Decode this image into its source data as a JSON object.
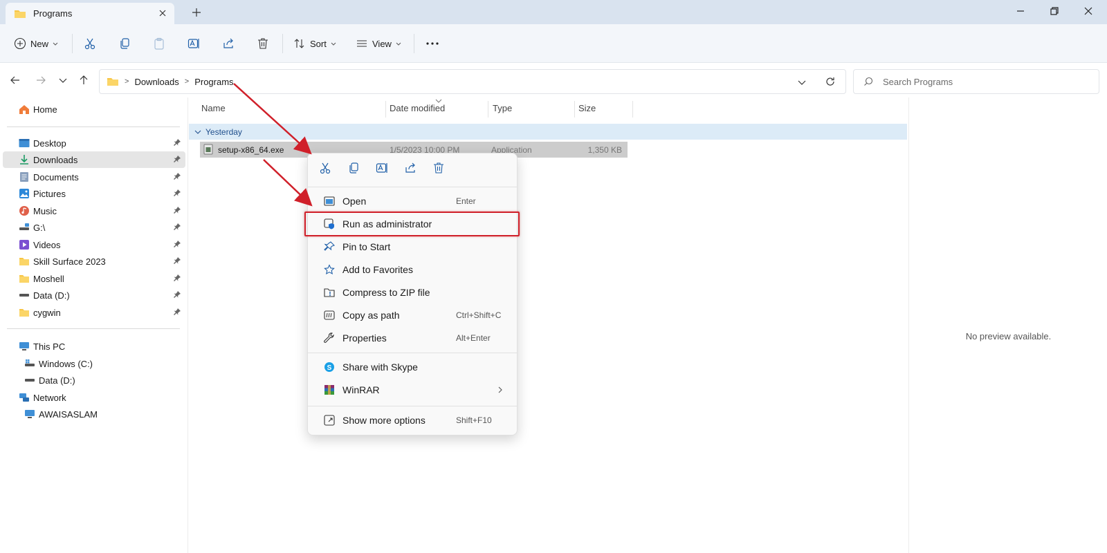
{
  "window": {
    "tab_title": "Programs"
  },
  "toolbar": {
    "new_label": "New",
    "sort_label": "Sort",
    "view_label": "View"
  },
  "address": {
    "crumbs": [
      "Downloads",
      "Programs"
    ],
    "search_placeholder": "Search Programs"
  },
  "sidebar": {
    "home": "Home",
    "pinned": [
      {
        "label": "Desktop",
        "icon": "desktop-icon"
      },
      {
        "label": "Downloads",
        "icon": "download-icon"
      },
      {
        "label": "Documents",
        "icon": "documents-icon"
      },
      {
        "label": "Pictures",
        "icon": "pictures-icon"
      },
      {
        "label": "Music",
        "icon": "music-icon"
      },
      {
        "label": "G:\\",
        "icon": "drive-icon"
      },
      {
        "label": "Videos",
        "icon": "videos-icon"
      },
      {
        "label": "Skill Surface 2023",
        "icon": "folder-icon"
      },
      {
        "label": "Moshell",
        "icon": "folder-icon"
      },
      {
        "label": "Data (D:)",
        "icon": "drive-icon"
      },
      {
        "label": "cygwin",
        "icon": "folder-icon"
      }
    ],
    "this_pc": "This PC",
    "drives": [
      "Windows (C:)",
      "Data (D:)"
    ],
    "network": "Network",
    "network_host": "AWAISASLAM"
  },
  "columns": {
    "name": "Name",
    "date": "Date modified",
    "type": "Type",
    "size": "Size"
  },
  "group_label": "Yesterday",
  "file": {
    "name": "setup-x86_64.exe",
    "date": "1/5/2023 10:00 PM",
    "type": "Application",
    "size": "1,350 KB"
  },
  "preview": {
    "message": "No preview available."
  },
  "context_menu": {
    "items": [
      {
        "label": "Open",
        "shortcut": "Enter"
      },
      {
        "label": "Run as administrator",
        "shortcut": ""
      },
      {
        "label": "Pin to Start",
        "shortcut": ""
      },
      {
        "label": "Add to Favorites",
        "shortcut": ""
      },
      {
        "label": "Compress to ZIP file",
        "shortcut": ""
      },
      {
        "label": "Copy as path",
        "shortcut": "Ctrl+Shift+C"
      },
      {
        "label": "Properties",
        "shortcut": "Alt+Enter"
      },
      {
        "label": "Share with Skype",
        "shortcut": ""
      },
      {
        "label": "WinRAR",
        "shortcut": ""
      },
      {
        "label": "Show more options",
        "shortcut": "Shift+F10"
      }
    ]
  },
  "colors": {
    "accent": "#0067c0",
    "annotation": "#d0202a",
    "folder": "#f8c544",
    "selection": "#cccccc"
  }
}
